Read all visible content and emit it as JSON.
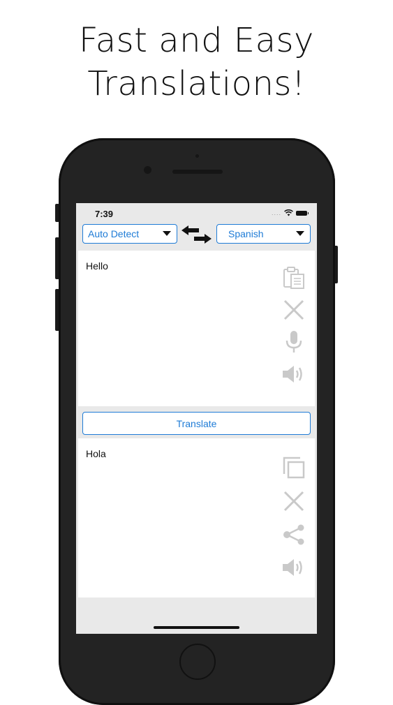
{
  "promo": {
    "line1": "Fast and Easy",
    "line2": "Translations!"
  },
  "status_bar": {
    "time": "7:39",
    "signal_dots": "...."
  },
  "languages": {
    "source": "Auto Detect",
    "target": "Spanish"
  },
  "input": {
    "text": "Hello",
    "actions": [
      "paste-icon",
      "clear-icon",
      "microphone-icon",
      "speaker-icon"
    ]
  },
  "translate_button": {
    "label": "Translate"
  },
  "output": {
    "text": "Hola",
    "actions": [
      "copy-icon",
      "clear-icon",
      "share-icon",
      "speaker-icon"
    ]
  },
  "colors": {
    "accent": "#1e7bd6",
    "icon_gray": "#c9c9c9",
    "phone_body": "#232323",
    "screen_bg": "#e9e9e9"
  }
}
